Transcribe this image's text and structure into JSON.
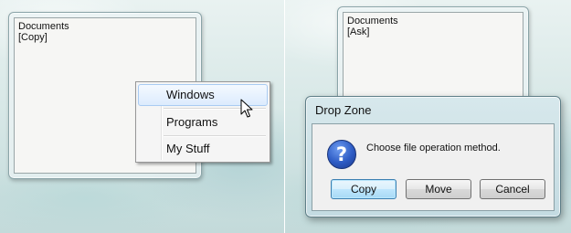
{
  "left_screen": {
    "gadget": {
      "line1": "Documents",
      "line2": "[Copy]"
    },
    "context_menu": {
      "items": [
        {
          "label": "Windows"
        },
        {
          "label": "Programs"
        },
        {
          "label": "My Stuff"
        }
      ]
    }
  },
  "right_screen": {
    "gadget": {
      "line1": "Documents",
      "line2": "[Ask]"
    },
    "dialog": {
      "title": "Drop Zone",
      "message": "Choose file operation method.",
      "icon": "question-icon",
      "buttons": {
        "copy": "Copy",
        "move": "Move",
        "cancel": "Cancel"
      }
    }
  },
  "colors": {
    "menu_highlight": "#dcebfd",
    "dialog_frame": "#c4dbe2",
    "icon_blue": "#2d5bc4"
  }
}
